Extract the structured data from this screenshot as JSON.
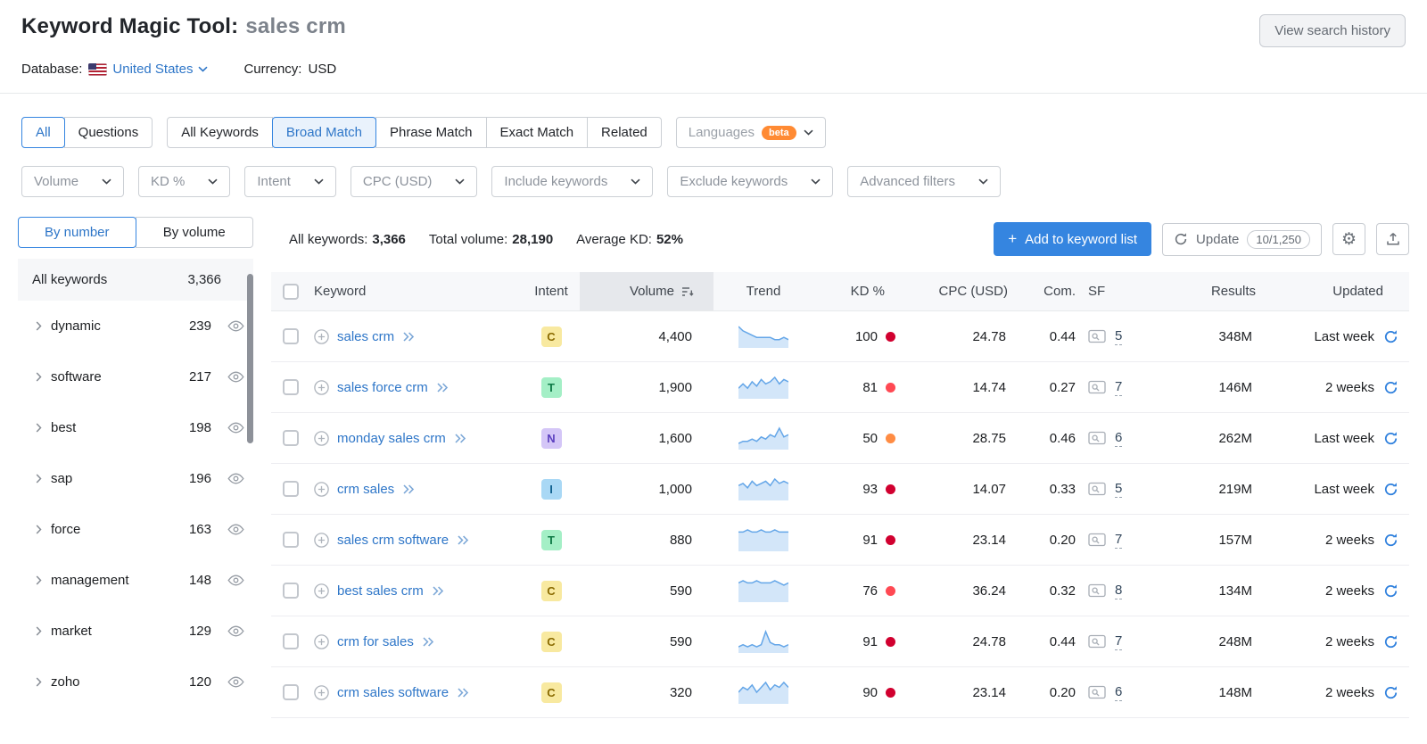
{
  "colors": {
    "link_blue": "#2e76c8",
    "primary_blue": "#3585e0",
    "beta_orange": "#ff8a33",
    "kd_red": "#d1002f",
    "kd_dark_orange": "#ff4953",
    "kd_orange": "#ff8c43",
    "spark_stroke": "#64a6e8",
    "spark_fill": "#d3e6f9"
  },
  "icons": {
    "gear": "⚙"
  },
  "header": {
    "title": "Keyword Magic Tool:",
    "query": "sales crm",
    "view_history_button": "View search history",
    "database_label": "Database:",
    "database_value": "United States",
    "currency_label": "Currency:",
    "currency_value": "USD"
  },
  "tabs": {
    "scope": [
      {
        "label": "All"
      },
      {
        "label": "Questions"
      }
    ],
    "match": [
      {
        "label": "All Keywords"
      },
      {
        "label": "Broad Match"
      },
      {
        "label": "Phrase Match"
      },
      {
        "label": "Exact Match"
      },
      {
        "label": "Related"
      }
    ],
    "languages": {
      "label": "Languages",
      "badge": "beta"
    }
  },
  "filters": [
    {
      "label": "Volume"
    },
    {
      "label": "KD %"
    },
    {
      "label": "Intent"
    },
    {
      "label": "CPC (USD)"
    },
    {
      "label": "Include keywords"
    },
    {
      "label": "Exclude keywords"
    },
    {
      "label": "Advanced filters"
    }
  ],
  "sidebar": {
    "toggle": [
      {
        "label": "By number"
      },
      {
        "label": "By volume"
      }
    ],
    "header": {
      "label": "All keywords",
      "count": "3,366"
    },
    "groups": [
      {
        "name": "dynamic",
        "count": "239"
      },
      {
        "name": "software",
        "count": "217"
      },
      {
        "name": "best",
        "count": "198"
      },
      {
        "name": "sap",
        "count": "196"
      },
      {
        "name": "force",
        "count": "163"
      },
      {
        "name": "management",
        "count": "148"
      },
      {
        "name": "market",
        "count": "129"
      },
      {
        "name": "zoho",
        "count": "120"
      }
    ]
  },
  "summary": {
    "all_keywords_label": "All keywords:",
    "all_keywords_value": "3,366",
    "total_volume_label": "Total volume:",
    "total_volume_value": "28,190",
    "avg_kd_label": "Average KD:",
    "avg_kd_value": "52%",
    "add_button": "Add to keyword list",
    "update_button": "Update",
    "update_quota": "10/1,250"
  },
  "table": {
    "columns": {
      "keyword": "Keyword",
      "intent": "Intent",
      "volume": "Volume",
      "trend": "Trend",
      "kd": "KD %",
      "cpc": "CPC (USD)",
      "com": "Com.",
      "sf": "SF",
      "results": "Results",
      "updated": "Updated"
    },
    "rows": [
      {
        "keyword": "sales crm",
        "intent": {
          "label": "C",
          "bg": "#f8e9a0",
          "fg": "#8a6a00"
        },
        "volume": "4,400",
        "trend": [
          9,
          7,
          6,
          5,
          4,
          4,
          4,
          4,
          3,
          3,
          4,
          3
        ],
        "kd": "100",
        "kd_color": "#d1002f",
        "cpc": "24.78",
        "com": "0.44",
        "sf": "5",
        "results": "348M",
        "updated": "Last week"
      },
      {
        "keyword": "sales force crm",
        "intent": {
          "label": "T",
          "bg": "#a4efc6",
          "fg": "#0e7a46"
        },
        "volume": "1,900",
        "trend": [
          4,
          6,
          4,
          7,
          5,
          8,
          6,
          7,
          9,
          6,
          8,
          7
        ],
        "kd": "81",
        "kd_color": "#ff4953",
        "cpc": "14.74",
        "com": "0.27",
        "sf": "7",
        "results": "146M",
        "updated": "2 weeks"
      },
      {
        "keyword": "monday sales crm",
        "intent": {
          "label": "N",
          "bg": "#d4c6f7",
          "fg": "#5b3fbf"
        },
        "volume": "1,600",
        "trend": [
          2,
          3,
          3,
          4,
          3,
          5,
          4,
          6,
          5,
          9,
          5,
          6
        ],
        "kd": "50",
        "kd_color": "#ff8c43",
        "cpc": "28.75",
        "com": "0.46",
        "sf": "6",
        "results": "262M",
        "updated": "Last week"
      },
      {
        "keyword": "crm sales",
        "intent": {
          "label": "I",
          "bg": "#a9d8f5",
          "fg": "#10618f"
        },
        "volume": "1,000",
        "trend": [
          6,
          7,
          5,
          8,
          6,
          7,
          8,
          6,
          9,
          7,
          8,
          7
        ],
        "kd": "93",
        "kd_color": "#d1002f",
        "cpc": "14.07",
        "com": "0.33",
        "sf": "5",
        "results": "219M",
        "updated": "Last week"
      },
      {
        "keyword": "sales crm software",
        "intent": {
          "label": "T",
          "bg": "#a4efc6",
          "fg": "#0e7a46"
        },
        "volume": "880",
        "trend": [
          8,
          8,
          9,
          8,
          8,
          9,
          8,
          8,
          9,
          8,
          8,
          8
        ],
        "kd": "91",
        "kd_color": "#d1002f",
        "cpc": "23.14",
        "com": "0.20",
        "sf": "7",
        "results": "157M",
        "updated": "2 weeks"
      },
      {
        "keyword": "best sales crm",
        "intent": {
          "label": "C",
          "bg": "#f8e9a0",
          "fg": "#8a6a00"
        },
        "volume": "590",
        "trend": [
          8,
          9,
          8,
          8,
          9,
          8,
          8,
          8,
          9,
          8,
          7,
          8
        ],
        "kd": "76",
        "kd_color": "#ff4953",
        "cpc": "36.24",
        "com": "0.32",
        "sf": "8",
        "results": "134M",
        "updated": "2 weeks"
      },
      {
        "keyword": "crm for sales",
        "intent": {
          "label": "C",
          "bg": "#f8e9a0",
          "fg": "#8a6a00"
        },
        "volume": "590",
        "trend": [
          2,
          3,
          2,
          3,
          2,
          3,
          9,
          4,
          3,
          3,
          2,
          3
        ],
        "kd": "91",
        "kd_color": "#d1002f",
        "cpc": "24.78",
        "com": "0.44",
        "sf": "7",
        "results": "248M",
        "updated": "2 weeks"
      },
      {
        "keyword": "crm sales software",
        "intent": {
          "label": "C",
          "bg": "#f8e9a0",
          "fg": "#8a6a00"
        },
        "volume": "320",
        "trend": [
          4,
          6,
          5,
          7,
          4,
          6,
          8,
          5,
          7,
          6,
          8,
          6
        ],
        "kd": "90",
        "kd_color": "#d1002f",
        "cpc": "23.14",
        "com": "0.20",
        "sf": "6",
        "results": "148M",
        "updated": "2 weeks"
      }
    ]
  }
}
